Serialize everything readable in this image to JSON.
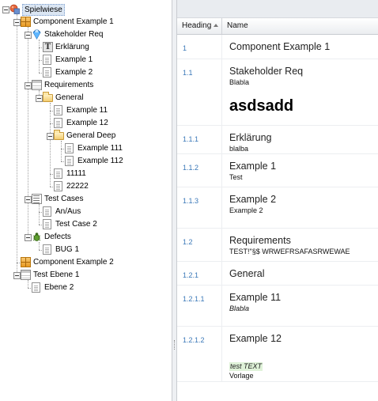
{
  "tree": {
    "items": [
      {
        "label": "Spielwiese",
        "icon": "globe-icon",
        "depth": 0,
        "expanded": true,
        "selected": true
      },
      {
        "label": "Component Example 1",
        "icon": "component-box-icon",
        "depth": 1,
        "expanded": true
      },
      {
        "label": "Stakeholder Req",
        "icon": "gem-icon",
        "depth": 2,
        "expanded": true
      },
      {
        "label": "Erklärung",
        "icon": "text-type-icon",
        "depth": 3
      },
      {
        "label": "Example 1",
        "icon": "page-icon",
        "depth": 3
      },
      {
        "label": "Example 2",
        "icon": "page-icon",
        "depth": 3
      },
      {
        "label": "Requirements",
        "icon": "table-icon",
        "depth": 2,
        "expanded": true
      },
      {
        "label": "General",
        "icon": "folder-open-icon",
        "depth": 3,
        "expanded": true
      },
      {
        "label": "Example 11",
        "icon": "page-icon",
        "depth": 4
      },
      {
        "label": "Example 12",
        "icon": "page-icon",
        "depth": 4
      },
      {
        "label": "General Deep",
        "icon": "folder-open-icon",
        "depth": 4,
        "expanded": true
      },
      {
        "label": "Example 111",
        "icon": "page-icon",
        "depth": 5
      },
      {
        "label": "Example 112",
        "icon": "page-icon",
        "depth": 5
      },
      {
        "label": "11111",
        "icon": "page-icon",
        "depth": 4
      },
      {
        "label": "22222",
        "icon": "page-icon",
        "depth": 4
      },
      {
        "label": "Test Cases",
        "icon": "list-stack-icon",
        "depth": 2,
        "expanded": true
      },
      {
        "label": "An/Aus",
        "icon": "page-icon",
        "depth": 3
      },
      {
        "label": "Test Case 2",
        "icon": "page-icon",
        "depth": 3
      },
      {
        "label": "Defects",
        "icon": "bug-icon",
        "depth": 2,
        "expanded": true
      },
      {
        "label": "BUG 1",
        "icon": "page-icon",
        "depth": 3
      },
      {
        "label": "Component Example 2",
        "icon": "component-box-icon",
        "depth": 1
      },
      {
        "label": "Test Ebene 1",
        "icon": "table-icon",
        "depth": 1,
        "expanded": true
      },
      {
        "label": "Ebene 2",
        "icon": "page-icon",
        "depth": 2
      }
    ]
  },
  "grid": {
    "columns": {
      "heading": "Heading",
      "name": "Name"
    },
    "sort": "ascending",
    "rows": [
      {
        "heading": "1",
        "title": "Component Example 1",
        "desc": ""
      },
      {
        "heading": "1.1",
        "title": "Stakeholder Req",
        "desc": "Blabla",
        "big": "asdsadd"
      },
      {
        "heading": "1.1.1",
        "title": "Erklärung",
        "desc": "blalba"
      },
      {
        "heading": "1.1.2",
        "title": "Example 1",
        "desc": "Test"
      },
      {
        "heading": "1.1.3",
        "title": "Example 2",
        "desc": "Example 2"
      },
      {
        "heading": "1.2",
        "title": "Requirements",
        "desc": "TEST!\"§$ WRWEFRSAFASRWEWAE"
      },
      {
        "heading": "1.2.1",
        "title": "General",
        "desc": ""
      },
      {
        "heading": "1.2.1.1",
        "title": "Example 11",
        "desc": "Blabla",
        "desc_style": "italic"
      },
      {
        "heading": "1.2.1.2",
        "title": "Example 12",
        "desc": "",
        "highlight": "test TEXT",
        "after": "Vorlage"
      }
    ]
  },
  "colors": {
    "selection": "#dbe6f3",
    "heading_link": "#3a78b8",
    "highlight_green": "#dff2d8"
  }
}
